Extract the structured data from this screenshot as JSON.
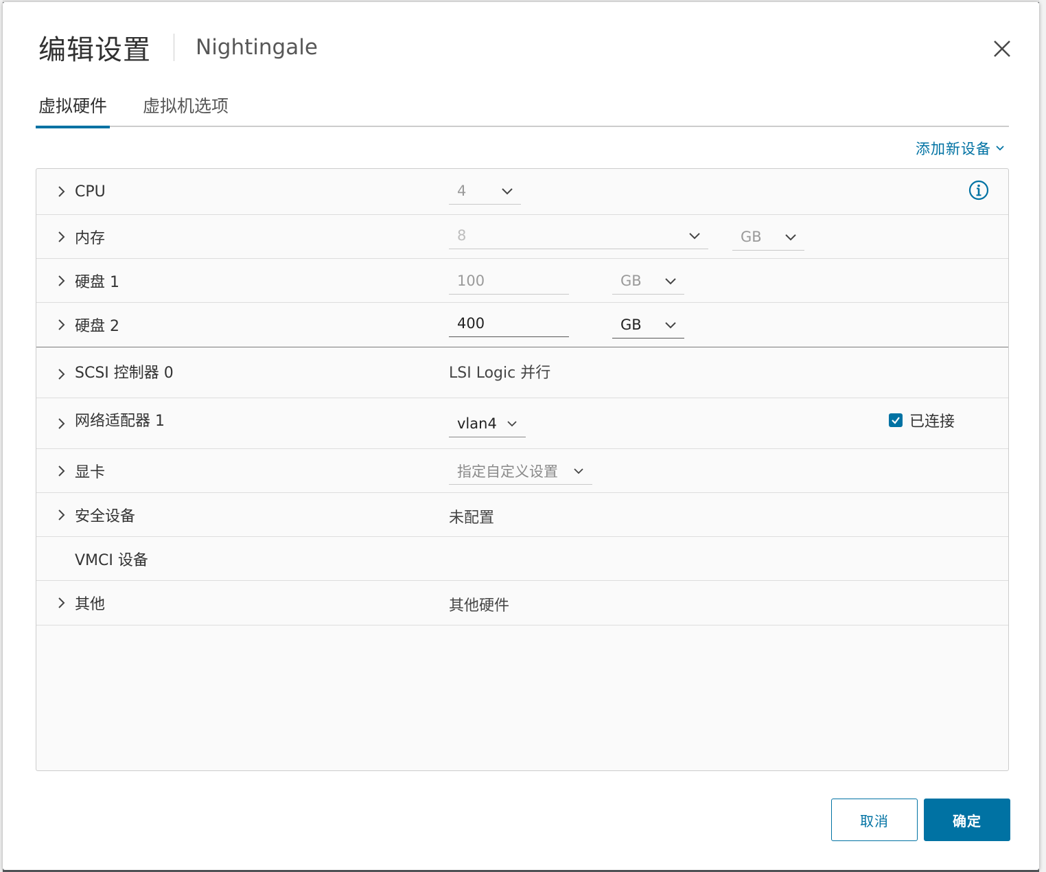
{
  "dialog": {
    "title": "编辑设置",
    "vm_name": "Nightingale"
  },
  "tabs": [
    {
      "label": "虚拟硬件",
      "active": true
    },
    {
      "label": "虚拟机选项",
      "active": false
    }
  ],
  "add_device_label": "添加新设备",
  "hardware": {
    "cpu": {
      "label": "CPU",
      "value": "4"
    },
    "memory": {
      "label": "内存",
      "value": "8",
      "unit": "GB"
    },
    "disk1": {
      "label": "硬盘 1",
      "value": "100",
      "unit": "GB"
    },
    "disk2": {
      "label": "硬盘 2",
      "value": "400",
      "unit": "GB"
    },
    "scsi": {
      "label": "SCSI 控制器 0",
      "value": "LSI Logic 并行"
    },
    "network": {
      "label": "网络适配器 1",
      "value": "vlan4",
      "connected_label": "已连接",
      "connected": true
    },
    "video": {
      "label": "显卡",
      "value": "指定自定义设置"
    },
    "security": {
      "label": "安全设备",
      "value": "未配置"
    },
    "vmci": {
      "label": "VMCI 设备"
    },
    "other": {
      "label": "其他",
      "value": "其他硬件"
    }
  },
  "buttons": {
    "cancel": "取消",
    "ok": "确定"
  },
  "colors": {
    "accent": "#0072a3",
    "panel_bg": "#fafafa"
  }
}
